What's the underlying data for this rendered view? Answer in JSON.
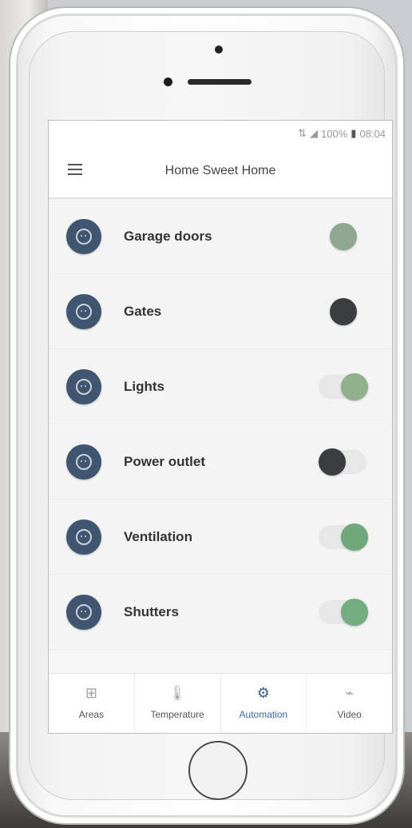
{
  "status_bar": {
    "network": "⇅",
    "signal": "◢",
    "battery_text": "100%",
    "battery_icon": "▮",
    "time": "08:04"
  },
  "app_bar": {
    "title": "Home Sweet Home"
  },
  "devices": [
    {
      "label": "Garage doors",
      "state": "mid",
      "knob_color": "#8fa78e",
      "track": false
    },
    {
      "label": "Gates",
      "state": "mid",
      "knob_color": "#3b3d40",
      "track": false
    },
    {
      "label": "Lights",
      "state": "on",
      "knob_color": "#8fb08b",
      "track": true
    },
    {
      "label": "Power outlet",
      "state": "off",
      "knob_color": "#3b3d40",
      "track": true
    },
    {
      "label": "Ventilation",
      "state": "on",
      "knob_color": "#6fa77a",
      "track": true
    },
    {
      "label": "Shutters",
      "state": "on",
      "knob_color": "#71ad7f",
      "track": true
    }
  ],
  "tabs": [
    {
      "label": "Areas",
      "icon": "⊞"
    },
    {
      "label": "Temperature",
      "icon": "🌡"
    },
    {
      "label": "Automation",
      "icon": "⚙"
    },
    {
      "label": "Video",
      "icon": "⌁"
    }
  ],
  "active_tab": "Automation",
  "colors": {
    "accent": "#3b6aa3",
    "icon_bg": "#3f5570"
  }
}
